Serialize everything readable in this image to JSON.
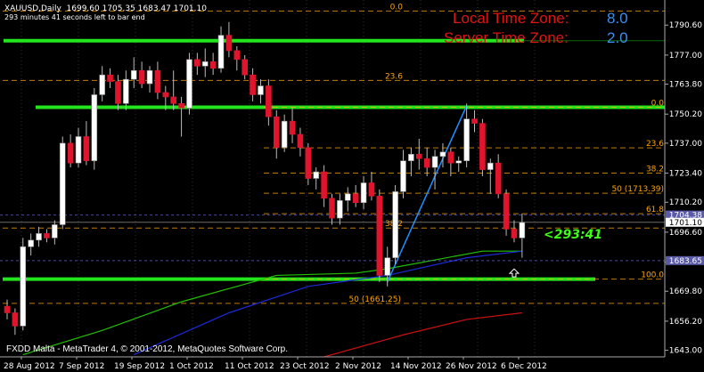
{
  "header": {
    "symbol": "XAUUSD,Daily",
    "ohlc": "1699.60 1705.35 1683.47 1701.10",
    "bar_time": "293 minutes 41 seconds left to bar end"
  },
  "timezone": {
    "local_label": "Local Time Zone:",
    "local_value": "8.0",
    "server_label": "Server Time Zone:",
    "server_value": "2.0"
  },
  "countdown": "<293:41",
  "copyright": "FXDD Malta - MetaTrader 4, © 2001-2012, MetaQuotes Software Corp.",
  "colors": {
    "background": "#000000",
    "bull_candle": "#ffffff",
    "bear_candle": "#e0142d",
    "sr_line": "#22e51e",
    "fib": "#ffa500",
    "ma_fast": "#22c000",
    "ma_mid": "#1c2ad8",
    "ma_slow": "#cc1010",
    "trendline": "#1e90ff",
    "price_line": "#8080a0"
  },
  "chart_data": {
    "type": "candlestick",
    "symbol": "XAUUSD",
    "timeframe": "Daily",
    "ylim": [
      1640,
      1802
    ],
    "y_ticks": [
      "1790.60",
      "1777.00",
      "1763.80",
      "1750.20",
      "1737.00",
      "1723.40",
      "1710.20",
      "1696.60",
      "1683.00",
      "1669.80",
      "1656.20",
      "1643.00"
    ],
    "x_labels": [
      "28 Aug 2012",
      "7 Sep 2012",
      "19 Sep 2012",
      "1 Oct 2012",
      "11 Oct 2012",
      "23 Oct 2012",
      "2 Nov 2012",
      "14 Nov 2012",
      "26 Nov 2012",
      "6 Dec 2012"
    ],
    "candles": [
      [
        1663,
        1666,
        1657,
        1660
      ],
      [
        1660,
        1662,
        1650,
        1654
      ],
      [
        1654,
        1694,
        1652,
        1690
      ],
      [
        1690,
        1696,
        1686,
        1693
      ],
      [
        1693,
        1699,
        1690,
        1696
      ],
      [
        1696,
        1698,
        1692,
        1694
      ],
      [
        1694,
        1702,
        1691,
        1700
      ],
      [
        1700,
        1740,
        1698,
        1737
      ],
      [
        1737,
        1741,
        1726,
        1728
      ],
      [
        1728,
        1744,
        1726,
        1740
      ],
      [
        1740,
        1747,
        1727,
        1729
      ],
      [
        1729,
        1762,
        1725,
        1759
      ],
      [
        1759,
        1772,
        1756,
        1768
      ],
      [
        1768,
        1771,
        1762,
        1765
      ],
      [
        1765,
        1768,
        1752,
        1755
      ],
      [
        1755,
        1770,
        1752,
        1766
      ],
      [
        1766,
        1776,
        1762,
        1770
      ],
      [
        1770,
        1774,
        1762,
        1764
      ],
      [
        1764,
        1772,
        1760,
        1770
      ],
      [
        1770,
        1774,
        1757,
        1760
      ],
      [
        1760,
        1763,
        1752,
        1758
      ],
      [
        1758,
        1770,
        1752,
        1755
      ],
      [
        1755,
        1758,
        1740,
        1753
      ],
      [
        1753,
        1778,
        1750,
        1775
      ],
      [
        1775,
        1778,
        1768,
        1772
      ],
      [
        1772,
        1780,
        1767,
        1774
      ],
      [
        1774,
        1778,
        1768,
        1771
      ],
      [
        1771,
        1790,
        1769,
        1786
      ],
      [
        1786,
        1792,
        1776,
        1779
      ],
      [
        1779,
        1781,
        1770,
        1775
      ],
      [
        1775,
        1777,
        1766,
        1768
      ],
      [
        1768,
        1771,
        1756,
        1759
      ],
      [
        1759,
        1766,
        1755,
        1763
      ],
      [
        1763,
        1766,
        1745,
        1749
      ],
      [
        1749,
        1752,
        1730,
        1735
      ],
      [
        1735,
        1750,
        1733,
        1747
      ],
      [
        1747,
        1753,
        1737,
        1741
      ],
      [
        1741,
        1744,
        1731,
        1735
      ],
      [
        1735,
        1737,
        1718,
        1721
      ],
      [
        1721,
        1726,
        1716,
        1724
      ],
      [
        1724,
        1727,
        1708,
        1712
      ],
      [
        1712,
        1714,
        1700,
        1703
      ],
      [
        1703,
        1714,
        1700,
        1711
      ],
      [
        1711,
        1717,
        1706,
        1714
      ],
      [
        1714,
        1718,
        1708,
        1710
      ],
      [
        1710,
        1722,
        1707,
        1719
      ],
      [
        1719,
        1724,
        1711,
        1713
      ],
      [
        1713,
        1716,
        1674,
        1677
      ],
      [
        1677,
        1690,
        1672,
        1685
      ],
      [
        1685,
        1718,
        1682,
        1715
      ],
      [
        1715,
        1734,
        1712,
        1729
      ],
      [
        1729,
        1735,
        1722,
        1732
      ],
      [
        1732,
        1739,
        1725,
        1730
      ],
      [
        1730,
        1735,
        1722,
        1726
      ],
      [
        1726,
        1734,
        1716,
        1731
      ],
      [
        1731,
        1737,
        1726,
        1733
      ],
      [
        1733,
        1735,
        1722,
        1728
      ],
      [
        1728,
        1731,
        1724,
        1729
      ],
      [
        1729,
        1755,
        1726,
        1748
      ],
      [
        1748,
        1752,
        1742,
        1746
      ],
      [
        1746,
        1748,
        1722,
        1725
      ],
      [
        1725,
        1730,
        1714,
        1728
      ],
      [
        1728,
        1732,
        1712,
        1714
      ],
      [
        1714,
        1716,
        1695,
        1698
      ],
      [
        1698,
        1702,
        1692,
        1694
      ],
      [
        1694,
        1705,
        1685,
        1701
      ]
    ],
    "levels": [
      {
        "name": "resistance-top",
        "price": 1783.5
      },
      {
        "name": "resistance-mid",
        "price": 1753.3
      },
      {
        "name": "support",
        "price": 1675.3
      }
    ],
    "fib_upper": [
      {
        "label": "0.0",
        "price": 1753.3
      },
      {
        "label": "23.6",
        "price": 1734.9
      },
      {
        "label": "38.2",
        "price": 1723.4
      },
      {
        "label": "50 (1713.39)",
        "price": 1714.3
      },
      {
        "label": "61.8",
        "price": 1705.0
      },
      {
        "label": "100.0",
        "price": 1675.3
      }
    ],
    "fib_lower": [
      {
        "label": "0.0",
        "price": 1797.0
      },
      {
        "label": "23.6",
        "price": 1765.5
      },
      {
        "label": "38.2",
        "price": 1698.5
      },
      {
        "label": "50 (1661.25)",
        "price": 1664.3
      }
    ],
    "trendline": {
      "from": [
        48,
        1674
      ],
      "to": [
        58,
        1754
      ]
    },
    "ma_fast": [
      [
        2,
        1641
      ],
      [
        12,
        1652
      ],
      [
        22,
        1665
      ],
      [
        34,
        1677
      ],
      [
        44,
        1678
      ],
      [
        48,
        1680
      ],
      [
        60,
        1688
      ],
      [
        65,
        1688
      ]
    ],
    "ma_mid": [
      [
        16,
        1641
      ],
      [
        28,
        1660
      ],
      [
        38,
        1672
      ],
      [
        48,
        1677
      ],
      [
        58,
        1685
      ],
      [
        65,
        1688
      ]
    ],
    "ma_slow": [
      [
        40,
        1640
      ],
      [
        50,
        1650
      ],
      [
        58,
        1657
      ],
      [
        65,
        1660
      ]
    ],
    "price_markers": [
      {
        "label": "1704.38",
        "price": 1704.4
      },
      {
        "label": "1701.10",
        "price": 1701.1
      },
      {
        "label": "1683.65",
        "price": 1683.7
      }
    ],
    "arrow_price": 1677.5
  }
}
